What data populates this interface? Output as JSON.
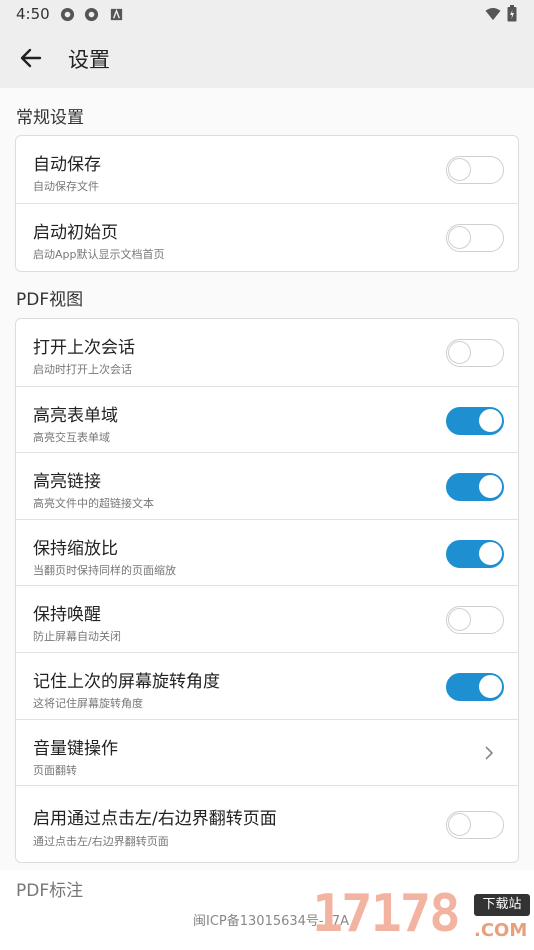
{
  "status_bar": {
    "time": "4:50"
  },
  "toolbar": {
    "title": "设置"
  },
  "sections": [
    {
      "header": "常规设置",
      "items": [
        {
          "title": "自动保存",
          "subtitle": "自动保存文件",
          "control": "toggle",
          "on": false
        },
        {
          "title": "启动初始页",
          "subtitle": "启动App默认显示文档首页",
          "control": "toggle",
          "on": false
        }
      ]
    },
    {
      "header": "PDF视图",
      "items": [
        {
          "title": "打开上次会话",
          "subtitle": "启动时打开上次会话",
          "control": "toggle",
          "on": false
        },
        {
          "title": "高亮表单域",
          "subtitle": "高亮交互表单域",
          "control": "toggle",
          "on": true
        },
        {
          "title": "高亮链接",
          "subtitle": "高亮文件中的超链接文本",
          "control": "toggle",
          "on": true
        },
        {
          "title": "保持缩放比",
          "subtitle": "当翻页时保持同样的页面缩放",
          "control": "toggle",
          "on": true
        },
        {
          "title": "保持唤醒",
          "subtitle": "防止屏幕自动关闭",
          "control": "toggle",
          "on": false
        },
        {
          "title": "记住上次的屏幕旋转角度",
          "subtitle": "这将记住屏幕旋转角度",
          "control": "toggle",
          "on": true
        },
        {
          "title": "音量键操作",
          "subtitle": "页面翻转",
          "control": "chevron"
        },
        {
          "title": "启用通过点击左/右边界翻转页面",
          "subtitle": "通过点击左/右边界翻转页面",
          "control": "toggle",
          "on": false
        }
      ]
    }
  ],
  "partial_section_header": "PDF标注",
  "footer": {
    "icp": "闽ICP备13015634号-17A"
  },
  "watermark": {
    "number": "17178",
    "badge": "下载站",
    "domain": ".COM"
  },
  "colors": {
    "toggle_on": "#1e8fd1",
    "toggle_off_border": "#cfcfcf"
  },
  "icons": [
    "back-arrow-icon",
    "chevron-right-icon",
    "wifi-icon",
    "battery-icon",
    "notification-icon"
  ]
}
